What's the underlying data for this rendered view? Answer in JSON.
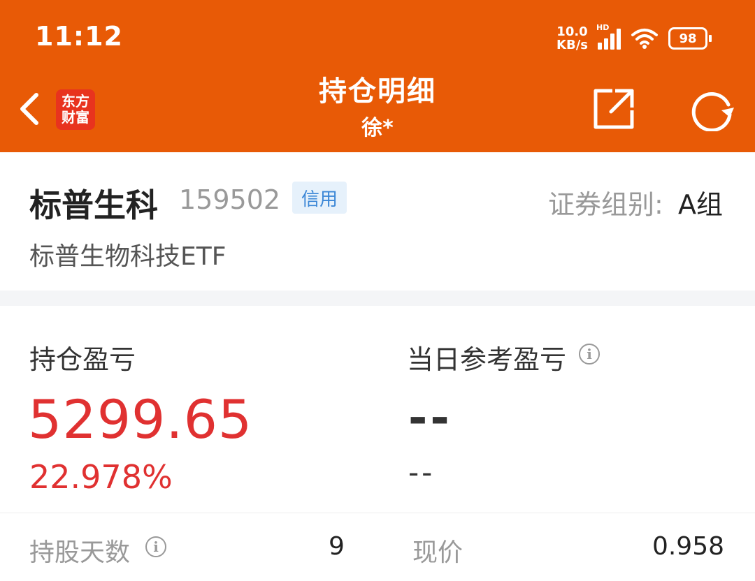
{
  "status_bar": {
    "time": "11:12",
    "speed_value": "10.0",
    "speed_unit": "KB/s",
    "hd": "HD",
    "battery": "98"
  },
  "header": {
    "title": "持仓明细",
    "subtitle": "徐*",
    "logo_line1": "东方",
    "logo_line2": "财富",
    "icons": [
      "back-arrow-icon",
      "share-icon",
      "refresh-icon"
    ],
    "background": "#e85a06"
  },
  "stock": {
    "short_name": "标普生科",
    "code": "159502",
    "badge": "信用",
    "group_label": "证券组别:",
    "group_value": "A组",
    "full_name": "标普生物科技ETF"
  },
  "profit": {
    "holding_label": "持仓盈亏",
    "holding_value": "5299.65",
    "holding_pct": "22.978%",
    "today_label": "当日参考盈亏",
    "today_value": "--",
    "today_pct": "--",
    "positive_color": "#e03131"
  },
  "details": {
    "days_label": "持股天数",
    "days_value": "9",
    "price_label": "现价",
    "price_value": "0.958"
  }
}
